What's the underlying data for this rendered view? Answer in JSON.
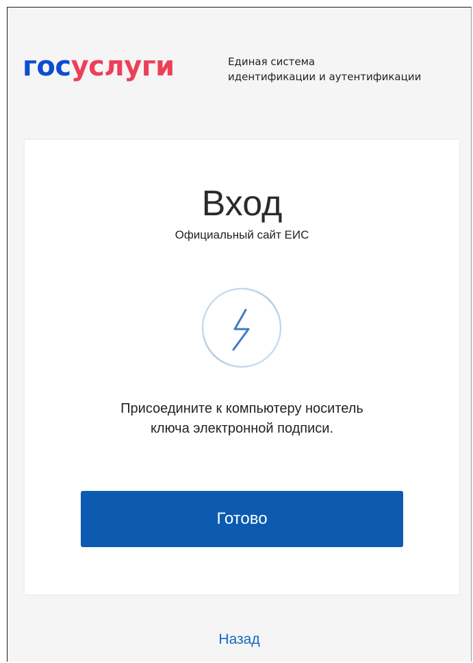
{
  "header": {
    "logo_part1": "гос",
    "logo_part2": "услуги",
    "tagline_line1": "Единая система",
    "tagline_line2": "идентификации и аутентификации"
  },
  "card": {
    "title": "Вход",
    "subtitle": "Официальный сайт ЕИС",
    "icon": "lightning-bolt-icon",
    "instruction_line1": "Присоедините к компьютеру носитель",
    "instruction_line2": "ключа электронной подписи.",
    "done_label": "Готово"
  },
  "footer": {
    "back_label": "Назад"
  },
  "colors": {
    "logo_blue": "#0d4cd3",
    "logo_red": "#ee3f58",
    "button_blue": "#0d5bb1",
    "link_blue": "#1565c0",
    "page_background": "#f5f5f5"
  }
}
